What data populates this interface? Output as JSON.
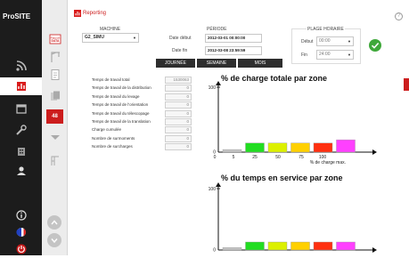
{
  "sidebar": {
    "logo_pro": "Pro",
    "logo_site": "SITE",
    "items": [
      {
        "icon": "rss-icon"
      },
      {
        "icon": "reporting-icon"
      },
      {
        "icon": "calendar-icon"
      },
      {
        "icon": "tools-icon"
      },
      {
        "icon": "building-icon"
      },
      {
        "icon": "users-icon"
      },
      {
        "icon": "info-icon"
      },
      {
        "icon": "flag-icon"
      },
      {
        "icon": "power-icon"
      }
    ]
  },
  "header": {
    "title": "Reporting",
    "help": "?"
  },
  "subbar": {
    "items": [
      {
        "icon": "data-icon",
        "label": "Rapport DATA"
      },
      {
        "icon": "crane-icon"
      },
      {
        "icon": "document-icon"
      },
      {
        "icon": "copy-icon"
      },
      {
        "icon": "chart-icon"
      },
      {
        "icon": "badge-icon",
        "label": "48"
      },
      {
        "icon": "crane-small-icon"
      }
    ]
  },
  "filters": {
    "machine_label": "MACHINE",
    "machine_value": "G2_SIMU",
    "period_label": "PÉRIODE",
    "start_label": "Date début",
    "start_value": "2012-03-01 00:00:00",
    "end_label": "Date fin",
    "end_value": "2012-03-08 23:59:59",
    "time_range_label": "PLAGE HORAIRE",
    "time_start_label": "Début",
    "time_start_value": "00:00",
    "time_end_label": "Fin",
    "time_end_value": "24:00",
    "buttons": [
      "JOURNÉE",
      "SEMAINE",
      "MOIS"
    ]
  },
  "stats": [
    {
      "label": "Temps de travail total",
      "value": "1530063"
    },
    {
      "label": "Temps de travail de la distribution",
      "value": "0"
    },
    {
      "label": "Temps de travail du levage",
      "value": "0"
    },
    {
      "label": "Temps de travail de l'orientation",
      "value": "0"
    },
    {
      "label": "Temps de travail du télescopage",
      "value": "0"
    },
    {
      "label": "Temps de travail de la translation",
      "value": "0"
    },
    {
      "label": "Charge cumulée",
      "value": "0"
    },
    {
      "label": "Nombre de surmoments",
      "value": "0"
    },
    {
      "label": "Nombre de surcharges",
      "value": "0"
    }
  ],
  "chart_data": [
    {
      "type": "bar",
      "title": "% de charge totale par zone",
      "xlabel": "% de charge max.",
      "ylabel": "",
      "ylim": [
        0,
        100
      ],
      "yticks": [
        "0",
        "100"
      ],
      "xticks": [
        "0",
        "5",
        "25",
        "50",
        "75",
        "100"
      ],
      "values": [
        4,
        14,
        14,
        14,
        14,
        19
      ],
      "colors": [
        "#c4c4c4",
        "#22dd22",
        "#dcf000",
        "#ffd000",
        "#ff3010",
        "#ff40ff"
      ]
    },
    {
      "type": "bar",
      "title": "% du temps en service par zone",
      "xlabel": "",
      "ylabel": "",
      "ylim": [
        0,
        100
      ],
      "yticks": [
        "0",
        "100"
      ],
      "xticks": [],
      "values": [
        4,
        13,
        13,
        13,
        13,
        13
      ],
      "colors": [
        "#c4c4c4",
        "#22dd22",
        "#dcf000",
        "#ffd000",
        "#ff3010",
        "#ff40ff"
      ]
    }
  ]
}
